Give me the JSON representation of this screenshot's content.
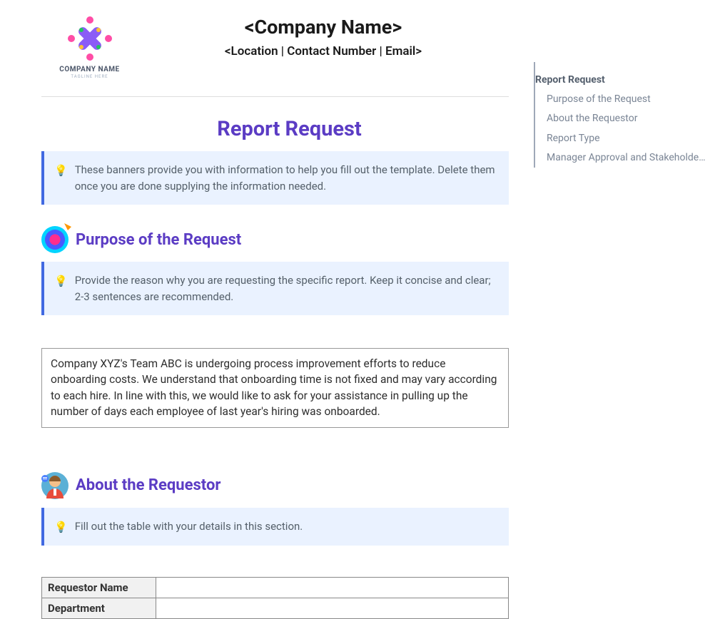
{
  "header": {
    "company_name": "<Company Name>",
    "subtitle": "<Location | Contact Number | Email>",
    "logo_label": "COMPANY NAME",
    "logo_tagline": "TAGLINE HERE"
  },
  "page_title": "Report Request",
  "banners": {
    "intro": "These banners provide you with information to help you fill out the template. Delete them once you are done supplying the information needed.",
    "purpose": "Provide the reason why you are requesting the specific report. Keep it concise and clear; 2-3 sentences are recommended.",
    "requestor": "Fill out the table with your details in this section."
  },
  "sections": {
    "purpose_title": "Purpose of the Request",
    "purpose_body": "Company XYZ's Team ABC is undergoing process improvement efforts to reduce onboarding costs. We understand that onboarding time is not fixed and may vary according to each hire. In line with this, we would like to ask for your assistance in pulling up the number of days each employee of last year's hiring was onboarded.",
    "requestor_title": "About the Requestor"
  },
  "table": {
    "rows": [
      {
        "label": "Requestor Name",
        "value": ""
      },
      {
        "label": "Department",
        "value": ""
      }
    ]
  },
  "sidebar": {
    "active": "Report Request",
    "items": [
      "Purpose of the Request",
      "About the Requestor",
      "Report Type",
      "Manager Approval and Stakeholder I..."
    ]
  }
}
